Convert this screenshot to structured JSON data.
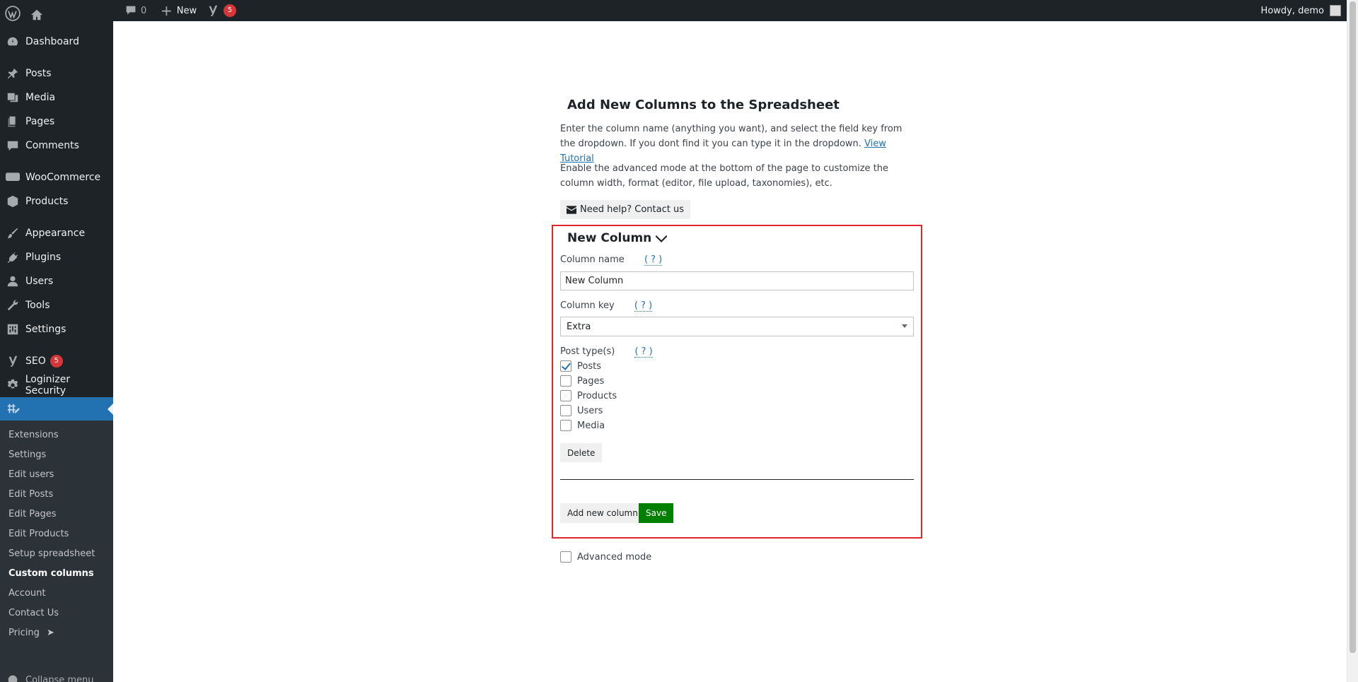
{
  "adminbar": {
    "comments_count": "0",
    "new_label": "New",
    "yoast_badge": "5",
    "howdy": "Howdy, demo"
  },
  "sidebar": {
    "items": [
      {
        "label": "Dashboard",
        "icon": "dashboard-icon"
      },
      {
        "label": "Posts",
        "icon": "pin-icon"
      },
      {
        "label": "Media",
        "icon": "media-icon"
      },
      {
        "label": "Pages",
        "icon": "pages-icon"
      },
      {
        "label": "Comments",
        "icon": "comment-icon"
      },
      {
        "label": "WooCommerce",
        "icon": "woo-icon"
      },
      {
        "label": "Products",
        "icon": "box-icon"
      },
      {
        "label": "Appearance",
        "icon": "brush-icon"
      },
      {
        "label": "Plugins",
        "icon": "plug-icon"
      },
      {
        "label": "Users",
        "icon": "user-icon"
      },
      {
        "label": "Tools",
        "icon": "wrench-icon"
      },
      {
        "label": "Settings",
        "icon": "settings-icon"
      },
      {
        "label": "SEO",
        "icon": "yoast-icon",
        "badge": "5"
      },
      {
        "label": "Loginizer Security",
        "icon": "gear-icon"
      }
    ],
    "submenu": [
      "Extensions",
      "Settings",
      "Edit users",
      "Edit Posts",
      "Edit Pages",
      "Edit Products",
      "Setup spreadsheet",
      "Custom columns",
      "Account",
      "Contact Us",
      "Pricing"
    ],
    "submenu_active": "Custom columns",
    "collapse_label": "Collapse menu"
  },
  "main": {
    "title": "Add New Columns to the Spreadsheet",
    "intro_text": "Enter the column name (anything you want), and select the field key from the dropdown. If you dont find it you can type it in the dropdown.",
    "tutorial_link": "View Tutorial",
    "intro2": "Enable the advanced mode at the bottom of the page to customize the column width, format (editor, file upload, taxonomies), etc.",
    "help_button": "Need help? Contact us",
    "column": {
      "heading": "New Column",
      "name_label": "Column name",
      "help_mark": "( ? )",
      "name_value": "New Column",
      "key_label": "Column key",
      "key_value": "Extra",
      "post_types_label": "Post type(s)",
      "post_types": [
        {
          "label": "Posts",
          "checked": true
        },
        {
          "label": "Pages",
          "checked": false
        },
        {
          "label": "Products",
          "checked": false
        },
        {
          "label": "Users",
          "checked": false
        },
        {
          "label": "Media",
          "checked": false
        }
      ],
      "delete_button": "Delete"
    },
    "add_button": "Add new column",
    "save_button": "Save",
    "advanced_mode_label": "Advanced mode",
    "accent_color": "#e0262a",
    "save_color": "#008000"
  }
}
